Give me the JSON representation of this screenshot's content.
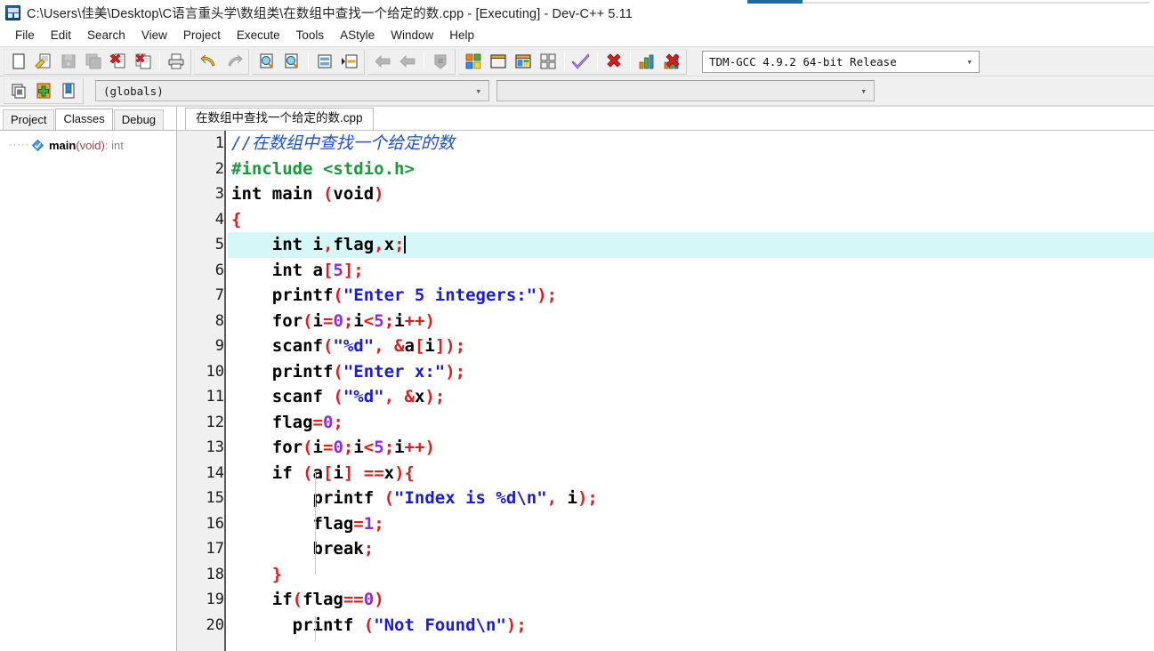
{
  "window": {
    "title": "C:\\Users\\佳美\\Desktop\\C语言重头学\\数组类\\在数组中查找一个给定的数.cpp - [Executing] - Dev-C++ 5.11",
    "app_icon": "devcpp-icon"
  },
  "menubar": {
    "items": [
      {
        "label": "File"
      },
      {
        "label": "Edit"
      },
      {
        "label": "Search"
      },
      {
        "label": "View"
      },
      {
        "label": "Project"
      },
      {
        "label": "Execute"
      },
      {
        "label": "Tools"
      },
      {
        "label": "AStyle"
      },
      {
        "label": "Window"
      },
      {
        "label": "Help"
      }
    ]
  },
  "toolbar": {
    "file_group": [
      {
        "name": "new-file-button",
        "icon": "new-file-icon",
        "enabled": true
      },
      {
        "name": "open-file-button",
        "icon": "open-folder-icon",
        "enabled": true
      },
      {
        "name": "save-button",
        "icon": "save-icon",
        "enabled": false
      },
      {
        "name": "save-all-button",
        "icon": "save-all-icon",
        "enabled": false
      },
      {
        "name": "close-file-button",
        "icon": "close-red-x-icon",
        "enabled": true
      },
      {
        "name": "close-all-button",
        "icon": "close-all-red-x-icon",
        "enabled": true
      },
      {
        "name": "print-button",
        "icon": "printer-icon",
        "enabled": true
      }
    ],
    "edit_group": [
      {
        "name": "undo-button",
        "icon": "undo-arrow-icon",
        "enabled": true
      },
      {
        "name": "redo-button",
        "icon": "redo-arrow-icon",
        "enabled": false
      }
    ],
    "search_group": [
      {
        "name": "find-button",
        "icon": "find-magnifier-icon",
        "enabled": true
      },
      {
        "name": "find-next-button",
        "icon": "find-next-magnifier-icon",
        "enabled": true
      },
      {
        "name": "goto-line-button",
        "icon": "goto-line-icon",
        "enabled": true
      },
      {
        "name": "goto-function-button",
        "icon": "goto-function-icon",
        "enabled": true
      }
    ],
    "project_group": [
      {
        "name": "back-button",
        "icon": "back-arrow-icon",
        "enabled": false
      },
      {
        "name": "forward-button",
        "icon": "forward-arrow-icon",
        "enabled": false
      },
      {
        "name": "unit-info-button",
        "icon": "unit-info-icon",
        "enabled": false
      }
    ],
    "compile_group": [
      {
        "name": "compile-button",
        "icon": "compile-blocks-icon",
        "enabled": true
      },
      {
        "name": "run-button",
        "icon": "run-window-icon",
        "enabled": true
      },
      {
        "name": "compile-run-button",
        "icon": "compile-run-icon",
        "enabled": true
      },
      {
        "name": "rebuild-all-button",
        "icon": "rebuild-all-icon",
        "enabled": true
      },
      {
        "name": "syntax-check-button",
        "icon": "purple-check-icon",
        "enabled": true
      },
      {
        "name": "stop-execution-button",
        "icon": "stop-red-x-icon",
        "enabled": true
      },
      {
        "name": "profile-button",
        "icon": "profile-bars-icon",
        "enabled": true
      },
      {
        "name": "delete-profile-button",
        "icon": "delete-profile-icon",
        "enabled": true
      }
    ],
    "compiler_select": {
      "value": "TDM-GCC 4.9.2 64-bit Release",
      "caret": "chevron-down-icon"
    }
  },
  "toolbar_row2": {
    "buttons": [
      {
        "name": "insert-snippet-button",
        "icon": "insert-icon"
      },
      {
        "name": "add-to-project-button",
        "icon": "add-green-plus-icon"
      },
      {
        "name": "toggle-bookmark-button",
        "icon": "bookmark-icon"
      }
    ],
    "scope_select": {
      "value": "(globals)",
      "caret": "chevron-down-icon"
    },
    "symbol_select": {
      "value": "",
      "caret": "chevron-down-icon"
    }
  },
  "left_panel": {
    "tabs": [
      {
        "label": "Project",
        "active": false
      },
      {
        "label": "Classes",
        "active": true
      },
      {
        "label": "Debug",
        "active": false
      }
    ],
    "tree": [
      {
        "icon": "function-blue-diamond-icon",
        "name": "main",
        "args": "(void)",
        "return": ": int"
      }
    ]
  },
  "editor": {
    "tabs": [
      {
        "label": "在数组中查找一个给定的数.cpp",
        "active": true
      }
    ],
    "active_line": 5,
    "colors": {
      "comment": "#1d4ed8",
      "preprocessor": "#1a9a3c",
      "string": "#1b1bd4",
      "number": "#8a2be2",
      "punctuation": "#e01b1b",
      "identifier": "#1a1a1a",
      "active_line_background": "#d6f7f7"
    },
    "lines": [
      {
        "n": 1,
        "fold": "none",
        "tokens": [
          {
            "t": "com",
            "v": "//在数组中查找一个给定的数"
          }
        ]
      },
      {
        "n": 2,
        "fold": "none",
        "tokens": [
          {
            "t": "pre",
            "v": "#include <stdio.h>"
          }
        ]
      },
      {
        "n": 3,
        "fold": "none",
        "tokens": [
          {
            "t": "kw",
            "v": "int main "
          },
          {
            "t": "pun",
            "v": "("
          },
          {
            "t": "kw",
            "v": "void"
          },
          {
            "t": "pun",
            "v": ")"
          }
        ]
      },
      {
        "n": 4,
        "fold": "open",
        "tokens": [
          {
            "t": "pun",
            "v": "{"
          }
        ]
      },
      {
        "n": 5,
        "fold": "bar",
        "tokens": [
          {
            "t": "kw",
            "v": "    int i"
          },
          {
            "t": "pun",
            "v": ","
          },
          {
            "t": "kw",
            "v": "flag"
          },
          {
            "t": "pun",
            "v": ","
          },
          {
            "t": "kw",
            "v": "x"
          },
          {
            "t": "pun",
            "v": ";"
          },
          {
            "t": "caret",
            "v": ""
          }
        ]
      },
      {
        "n": 6,
        "fold": "bar",
        "tokens": [
          {
            "t": "kw",
            "v": "    int a"
          },
          {
            "t": "pun",
            "v": "["
          },
          {
            "t": "num",
            "v": "5"
          },
          {
            "t": "pun",
            "v": "];"
          }
        ]
      },
      {
        "n": 7,
        "fold": "bar",
        "tokens": [
          {
            "t": "kw",
            "v": "    printf"
          },
          {
            "t": "pun",
            "v": "("
          },
          {
            "t": "str",
            "v": "\"Enter 5 integers:\""
          },
          {
            "t": "pun",
            "v": ");"
          }
        ]
      },
      {
        "n": 8,
        "fold": "bar",
        "tokens": [
          {
            "t": "kw",
            "v": "    for"
          },
          {
            "t": "pun",
            "v": "("
          },
          {
            "t": "kw",
            "v": "i"
          },
          {
            "t": "pun",
            "v": "="
          },
          {
            "t": "num",
            "v": "0"
          },
          {
            "t": "pun",
            "v": ";"
          },
          {
            "t": "kw",
            "v": "i"
          },
          {
            "t": "pun",
            "v": "<"
          },
          {
            "t": "num",
            "v": "5"
          },
          {
            "t": "pun",
            "v": ";"
          },
          {
            "t": "kw",
            "v": "i"
          },
          {
            "t": "pun",
            "v": "++)"
          }
        ]
      },
      {
        "n": 9,
        "fold": "bar",
        "tokens": [
          {
            "t": "kw",
            "v": "    scanf"
          },
          {
            "t": "pun",
            "v": "("
          },
          {
            "t": "str",
            "v": "\"%d\""
          },
          {
            "t": "pun",
            "v": ", &"
          },
          {
            "t": "kw",
            "v": "a"
          },
          {
            "t": "pun",
            "v": "["
          },
          {
            "t": "kw",
            "v": "i"
          },
          {
            "t": "pun",
            "v": "]);"
          }
        ]
      },
      {
        "n": 10,
        "fold": "bar",
        "tokens": [
          {
            "t": "kw",
            "v": "    printf"
          },
          {
            "t": "pun",
            "v": "("
          },
          {
            "t": "str",
            "v": "\"Enter x:\""
          },
          {
            "t": "pun",
            "v": ");"
          }
        ]
      },
      {
        "n": 11,
        "fold": "bar",
        "tokens": [
          {
            "t": "kw",
            "v": "    scanf "
          },
          {
            "t": "pun",
            "v": "("
          },
          {
            "t": "str",
            "v": "\"%d\""
          },
          {
            "t": "pun",
            "v": ", &"
          },
          {
            "t": "kw",
            "v": "x"
          },
          {
            "t": "pun",
            "v": ");"
          }
        ]
      },
      {
        "n": 12,
        "fold": "bar",
        "tokens": [
          {
            "t": "kw",
            "v": "    flag"
          },
          {
            "t": "pun",
            "v": "="
          },
          {
            "t": "num",
            "v": "0"
          },
          {
            "t": "pun",
            "v": ";"
          }
        ]
      },
      {
        "n": 13,
        "fold": "bar",
        "tokens": [
          {
            "t": "kw",
            "v": "    for"
          },
          {
            "t": "pun",
            "v": "("
          },
          {
            "t": "kw",
            "v": "i"
          },
          {
            "t": "pun",
            "v": "="
          },
          {
            "t": "num",
            "v": "0"
          },
          {
            "t": "pun",
            "v": ";"
          },
          {
            "t": "kw",
            "v": "i"
          },
          {
            "t": "pun",
            "v": "<"
          },
          {
            "t": "num",
            "v": "5"
          },
          {
            "t": "pun",
            "v": ";"
          },
          {
            "t": "kw",
            "v": "i"
          },
          {
            "t": "pun",
            "v": "++)"
          }
        ]
      },
      {
        "n": 14,
        "fold": "open2",
        "tokens": [
          {
            "t": "kw",
            "v": "    if "
          },
          {
            "t": "pun",
            "v": "("
          },
          {
            "t": "kw",
            "v": "a"
          },
          {
            "t": "pun",
            "v": "["
          },
          {
            "t": "kw",
            "v": "i"
          },
          {
            "t": "pun",
            "v": "] =="
          },
          {
            "t": "kw",
            "v": "x"
          },
          {
            "t": "pun",
            "v": "){"
          }
        ]
      },
      {
        "n": 15,
        "fold": "bar2",
        "tokens": [
          {
            "t": "kw",
            "v": "        printf "
          },
          {
            "t": "pun",
            "v": "("
          },
          {
            "t": "str",
            "v": "\"Index is %d\\n\""
          },
          {
            "t": "pun",
            "v": ", "
          },
          {
            "t": "kw",
            "v": "i"
          },
          {
            "t": "pun",
            "v": ");"
          }
        ]
      },
      {
        "n": 16,
        "fold": "bar2",
        "tokens": [
          {
            "t": "kw",
            "v": "        flag"
          },
          {
            "t": "pun",
            "v": "="
          },
          {
            "t": "num",
            "v": "1"
          },
          {
            "t": "pun",
            "v": ";"
          }
        ]
      },
      {
        "n": 17,
        "fold": "bar2",
        "tokens": [
          {
            "t": "kw",
            "v": "        break"
          },
          {
            "t": "pun",
            "v": ";"
          }
        ]
      },
      {
        "n": 18,
        "fold": "end",
        "tokens": [
          {
            "t": "pun",
            "v": "    }"
          }
        ]
      },
      {
        "n": 19,
        "fold": "bar",
        "tokens": [
          {
            "t": "kw",
            "v": "    if"
          },
          {
            "t": "pun",
            "v": "("
          },
          {
            "t": "kw",
            "v": "flag"
          },
          {
            "t": "pun",
            "v": "=="
          },
          {
            "t": "num",
            "v": "0"
          },
          {
            "t": "pun",
            "v": ")"
          }
        ]
      },
      {
        "n": 20,
        "fold": "bar",
        "tokens": [
          {
            "t": "kw",
            "v": "      printf "
          },
          {
            "t": "pun",
            "v": "("
          },
          {
            "t": "str",
            "v": "\"Not Found\\n\""
          },
          {
            "t": "pun",
            "v": ");"
          }
        ]
      }
    ]
  }
}
